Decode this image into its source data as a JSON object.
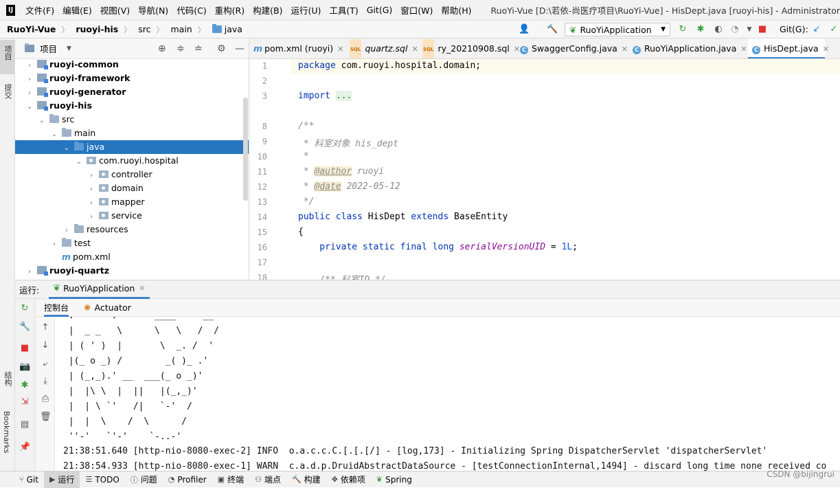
{
  "menubar": {
    "logo": "IJ",
    "items": [
      "文件(F)",
      "编辑(E)",
      "视图(V)",
      "导航(N)",
      "代码(C)",
      "重构(R)",
      "构建(B)",
      "运行(U)",
      "工具(T)",
      "Git(G)",
      "窗口(W)",
      "帮助(H)"
    ],
    "window_title": "RuoYi-Vue [D:\\若依-尚医疗项目\\RuoYi-Vue] - HisDept.java [ruoyi-his] - Administrator"
  },
  "navbar": {
    "breadcrumbs": [
      "RuoYi-Vue",
      "ruoyi-his",
      "src",
      "main",
      "java"
    ],
    "run_config": "RuoYiApplication",
    "git_label": "Git(G):"
  },
  "left_stripe": {
    "project": "项目",
    "commit": "提交",
    "structure": "结构",
    "bookmarks": "Bookmarks"
  },
  "project_panel": {
    "title": "项目",
    "tree": [
      {
        "label": "ruoyi-common",
        "depth": 0,
        "arrow": "›",
        "icon": "module",
        "bold": true
      },
      {
        "label": "ruoyi-framework",
        "depth": 0,
        "arrow": "›",
        "icon": "module",
        "bold": true
      },
      {
        "label": "ruoyi-generator",
        "depth": 0,
        "arrow": "›",
        "icon": "module",
        "bold": true
      },
      {
        "label": "ruoyi-his",
        "depth": 0,
        "arrow": "⌄",
        "icon": "module",
        "bold": true
      },
      {
        "label": "src",
        "depth": 1,
        "arrow": "⌄",
        "icon": "folder",
        "bold": false
      },
      {
        "label": "main",
        "depth": 2,
        "arrow": "⌄",
        "icon": "folder",
        "bold": false
      },
      {
        "label": "java",
        "depth": 3,
        "arrow": "⌄",
        "icon": "folder-blue",
        "bold": false,
        "selected": true
      },
      {
        "label": "com.ruoyi.hospital",
        "depth": 4,
        "arrow": "⌄",
        "icon": "package",
        "bold": false
      },
      {
        "label": "controller",
        "depth": 5,
        "arrow": "›",
        "icon": "package",
        "bold": false
      },
      {
        "label": "domain",
        "depth": 5,
        "arrow": "›",
        "icon": "package",
        "bold": false
      },
      {
        "label": "mapper",
        "depth": 5,
        "arrow": "›",
        "icon": "package",
        "bold": false
      },
      {
        "label": "service",
        "depth": 5,
        "arrow": "›",
        "icon": "package",
        "bold": false
      },
      {
        "label": "resources",
        "depth": 3,
        "arrow": "›",
        "icon": "folder",
        "bold": false
      },
      {
        "label": "test",
        "depth": 2,
        "arrow": "›",
        "icon": "folder",
        "bold": false
      },
      {
        "label": "pom.xml",
        "depth": 2,
        "arrow": "",
        "icon": "maven",
        "bold": false
      },
      {
        "label": "ruoyi-quartz",
        "depth": 0,
        "arrow": "›",
        "icon": "module",
        "bold": true
      }
    ]
  },
  "editor_tabs": [
    {
      "label": "pom.xml (ruoyi)",
      "icon": "maven",
      "active": false
    },
    {
      "label": "quartz.sql",
      "icon": "sql",
      "active": false
    },
    {
      "label": "ry_20210908.sql",
      "icon": "sql",
      "active": false
    },
    {
      "label": "SwaggerConfig.java",
      "icon": "class",
      "active": false
    },
    {
      "label": "RuoYiApplication.java",
      "icon": "class",
      "active": false
    },
    {
      "label": "HisDept.java",
      "icon": "class",
      "active": true
    }
  ],
  "editor": {
    "line_numbers": [
      "1",
      "2",
      "3",
      "8",
      "9",
      "10",
      "11",
      "12",
      "13",
      "14",
      "15",
      "16",
      "17",
      "18"
    ],
    "code": {
      "l1_kw": "package",
      "l1_rest": " com.ruoyi.hospital.domain;",
      "l3_kw": "import",
      "l3_fold": "...",
      "l8": "/**",
      "l9": " * 科室对象 his_dept",
      "l10": " *",
      "l11_pre": " * ",
      "l11_tag": "@author",
      "l11_val": " ruoyi",
      "l12_pre": " * ",
      "l12_tag": "@date",
      "l12_val": " 2022-05-12",
      "l13": " */",
      "l14_kw1": "public class",
      "l14_name": " HisDept ",
      "l14_kw2": "extends",
      "l14_base": " BaseEntity",
      "l15": "{",
      "l16_kw": "    private static final long ",
      "l16_field": "serialVersionUID",
      "l16_eq": " = ",
      "l16_num": "1L",
      "l16_end": ";",
      "l18": "    /** 科室ID */"
    }
  },
  "run_panel": {
    "label": "运行:",
    "config": "RuoYiApplication",
    "tabs": [
      "控制台",
      "Actuator"
    ],
    "console_lines": [
      " .-------.       ____     __        ",
      " |  _ _   \\      \\   \\   /  /    ",
      " | ( ' )  |       \\  _. /  '       ",
      " |(_ o _) /        _( )_ .'         ",
      " | (_,_).' __  ___(_ o _)'          ",
      " |  |\\ \\  |  ||   |(_,_)'         ",
      " |  | \\ `'   /|   `-'  /           ",
      " |  |  \\    /  \\      /           ",
      " ''-'   `'-'    `-..-'              ",
      "21:38:51.640 [http-nio-8080-exec-2] INFO  o.a.c.c.C.[.[.[/] - [log,173] - Initializing Spring DispatcherServlet 'dispatcherServlet'",
      "21:38:54.933 [http-nio-8080-exec-1] WARN  c.a.d.p.DruidAbstractDataSource - [testConnectionInternal,1494] - discard long time none received co"
    ]
  },
  "statusbar": {
    "items": [
      "Git",
      "运行",
      "TODO",
      "问题",
      "Profiler",
      "终端",
      "端点",
      "构建",
      "依赖项",
      "Spring"
    ],
    "watermark": "CSDN @bijingrui"
  }
}
